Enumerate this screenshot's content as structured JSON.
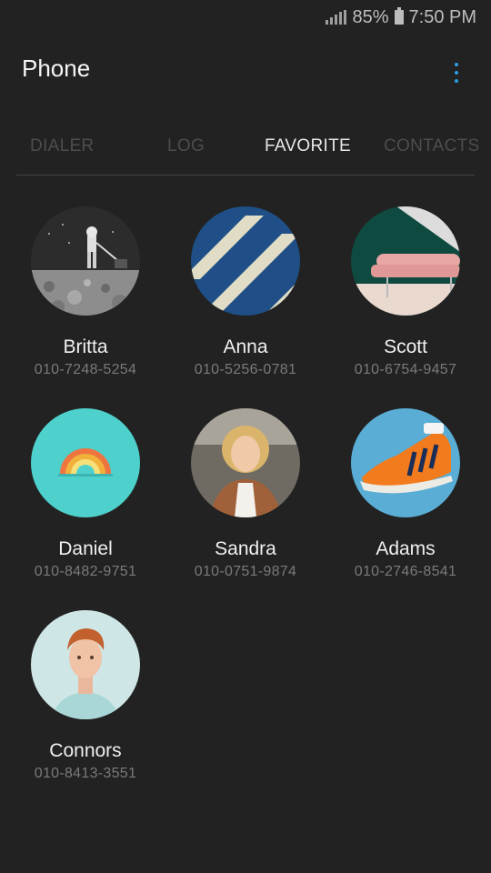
{
  "status": {
    "battery": "85%",
    "time": "7:50 PM"
  },
  "app": {
    "title": "Phone"
  },
  "tabs": [
    {
      "label": "DIALER",
      "active": false
    },
    {
      "label": "LOG",
      "active": false
    },
    {
      "label": "FAVORITE",
      "active": true
    },
    {
      "label": "CONTACTS",
      "active": false
    }
  ],
  "favorites": [
    {
      "name": "Britta",
      "phone": "010-7248-5254"
    },
    {
      "name": "Anna",
      "phone": "010-5256-0781"
    },
    {
      "name": "Scott",
      "phone": "010-6754-9457"
    },
    {
      "name": "Daniel",
      "phone": "010-8482-9751"
    },
    {
      "name": "Sandra",
      "phone": "010-0751-9874"
    },
    {
      "name": "Adams",
      "phone": "010-2746-8541"
    },
    {
      "name": "Connors",
      "phone": "010-8413-3551"
    }
  ],
  "colors": {
    "background": "#222222",
    "accent": "#2e9de2"
  }
}
